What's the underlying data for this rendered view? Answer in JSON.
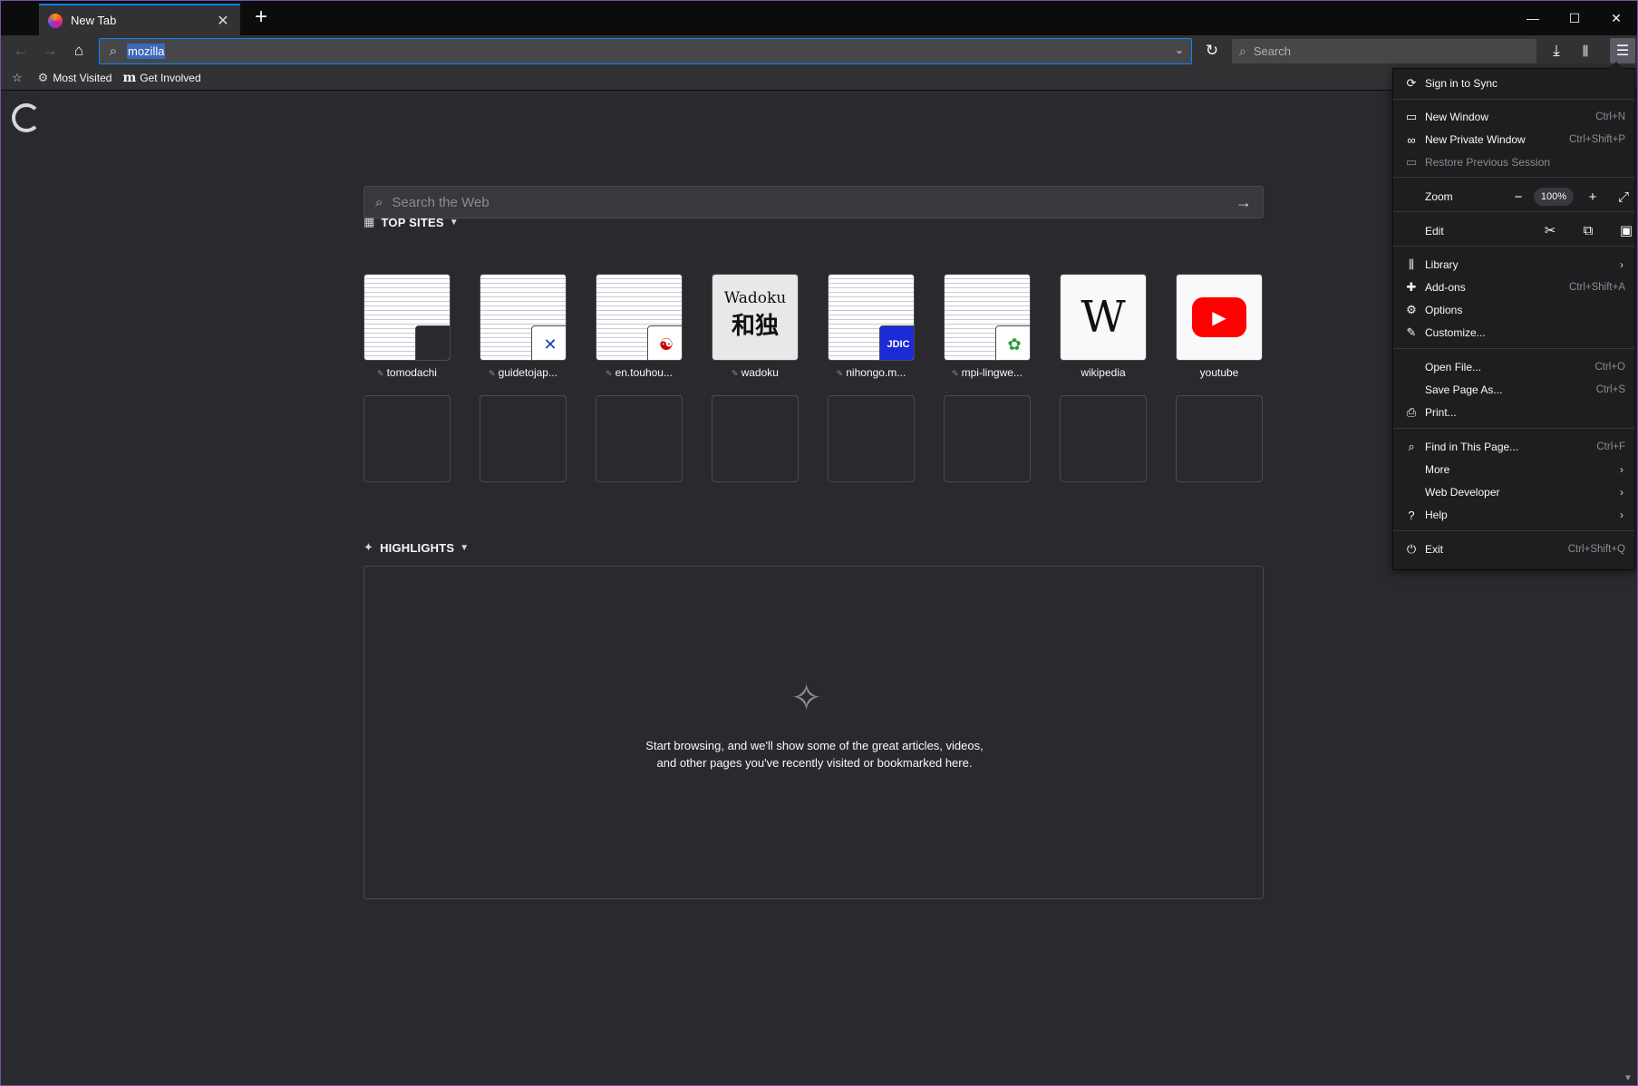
{
  "tab": {
    "title": "New Tab"
  },
  "urlbar": {
    "value": "mozilla"
  },
  "searchbar": {
    "placeholder": "Search"
  },
  "bookmarks": [
    {
      "label": "Most Visited",
      "icon": "gear-icon"
    },
    {
      "label": "Get Involved",
      "icon": "mozilla-m-icon"
    }
  ],
  "newtab": {
    "search_placeholder": "Search the Web",
    "top_sites_heading": "TOP SITES",
    "highlights_heading": "HIGHLIGHTS",
    "highlights_message": "Start browsing, and we'll show some of the great articles, videos, and other pages you've recently visited or bookmarked here.",
    "top_sites": [
      {
        "label": "tomodachi",
        "pinned": true
      },
      {
        "label": "guidetojap...",
        "pinned": true
      },
      {
        "label": "en.touhou...",
        "pinned": true
      },
      {
        "label": "wadoku",
        "pinned": true
      },
      {
        "label": "nihongo.m...",
        "pinned": true
      },
      {
        "label": "mpi-lingwe...",
        "pinned": true
      },
      {
        "label": "wikipedia",
        "pinned": false
      },
      {
        "label": "youtube",
        "pinned": false
      }
    ],
    "wadoku_tile": {
      "line1": "Wadoku",
      "line2": "和独"
    },
    "wiki_tile": {
      "letter": "W"
    }
  },
  "menu": {
    "sign_in": "Sign in to Sync",
    "new_window": {
      "label": "New Window",
      "shortcut": "Ctrl+N"
    },
    "private_window": {
      "label": "New Private Window",
      "shortcut": "Ctrl+Shift+P"
    },
    "restore_session": "Restore Previous Session",
    "zoom": {
      "label": "Zoom",
      "value": "100%"
    },
    "edit": "Edit",
    "library": "Library",
    "addons": {
      "label": "Add-ons",
      "shortcut": "Ctrl+Shift+A"
    },
    "options": "Options",
    "customize": "Customize...",
    "open_file": {
      "label": "Open File...",
      "shortcut": "Ctrl+O"
    },
    "save_page": {
      "label": "Save Page As...",
      "shortcut": "Ctrl+S"
    },
    "print": "Print...",
    "find": {
      "label": "Find in This Page...",
      "shortcut": "Ctrl+F"
    },
    "more": "More",
    "web_developer": "Web Developer",
    "help": "Help",
    "exit": {
      "label": "Exit",
      "shortcut": "Ctrl+Shift+Q"
    }
  },
  "colors": {
    "accent": "#0a84ff",
    "background": "#2a2a2e",
    "menu_bg": "#1e1e20"
  }
}
